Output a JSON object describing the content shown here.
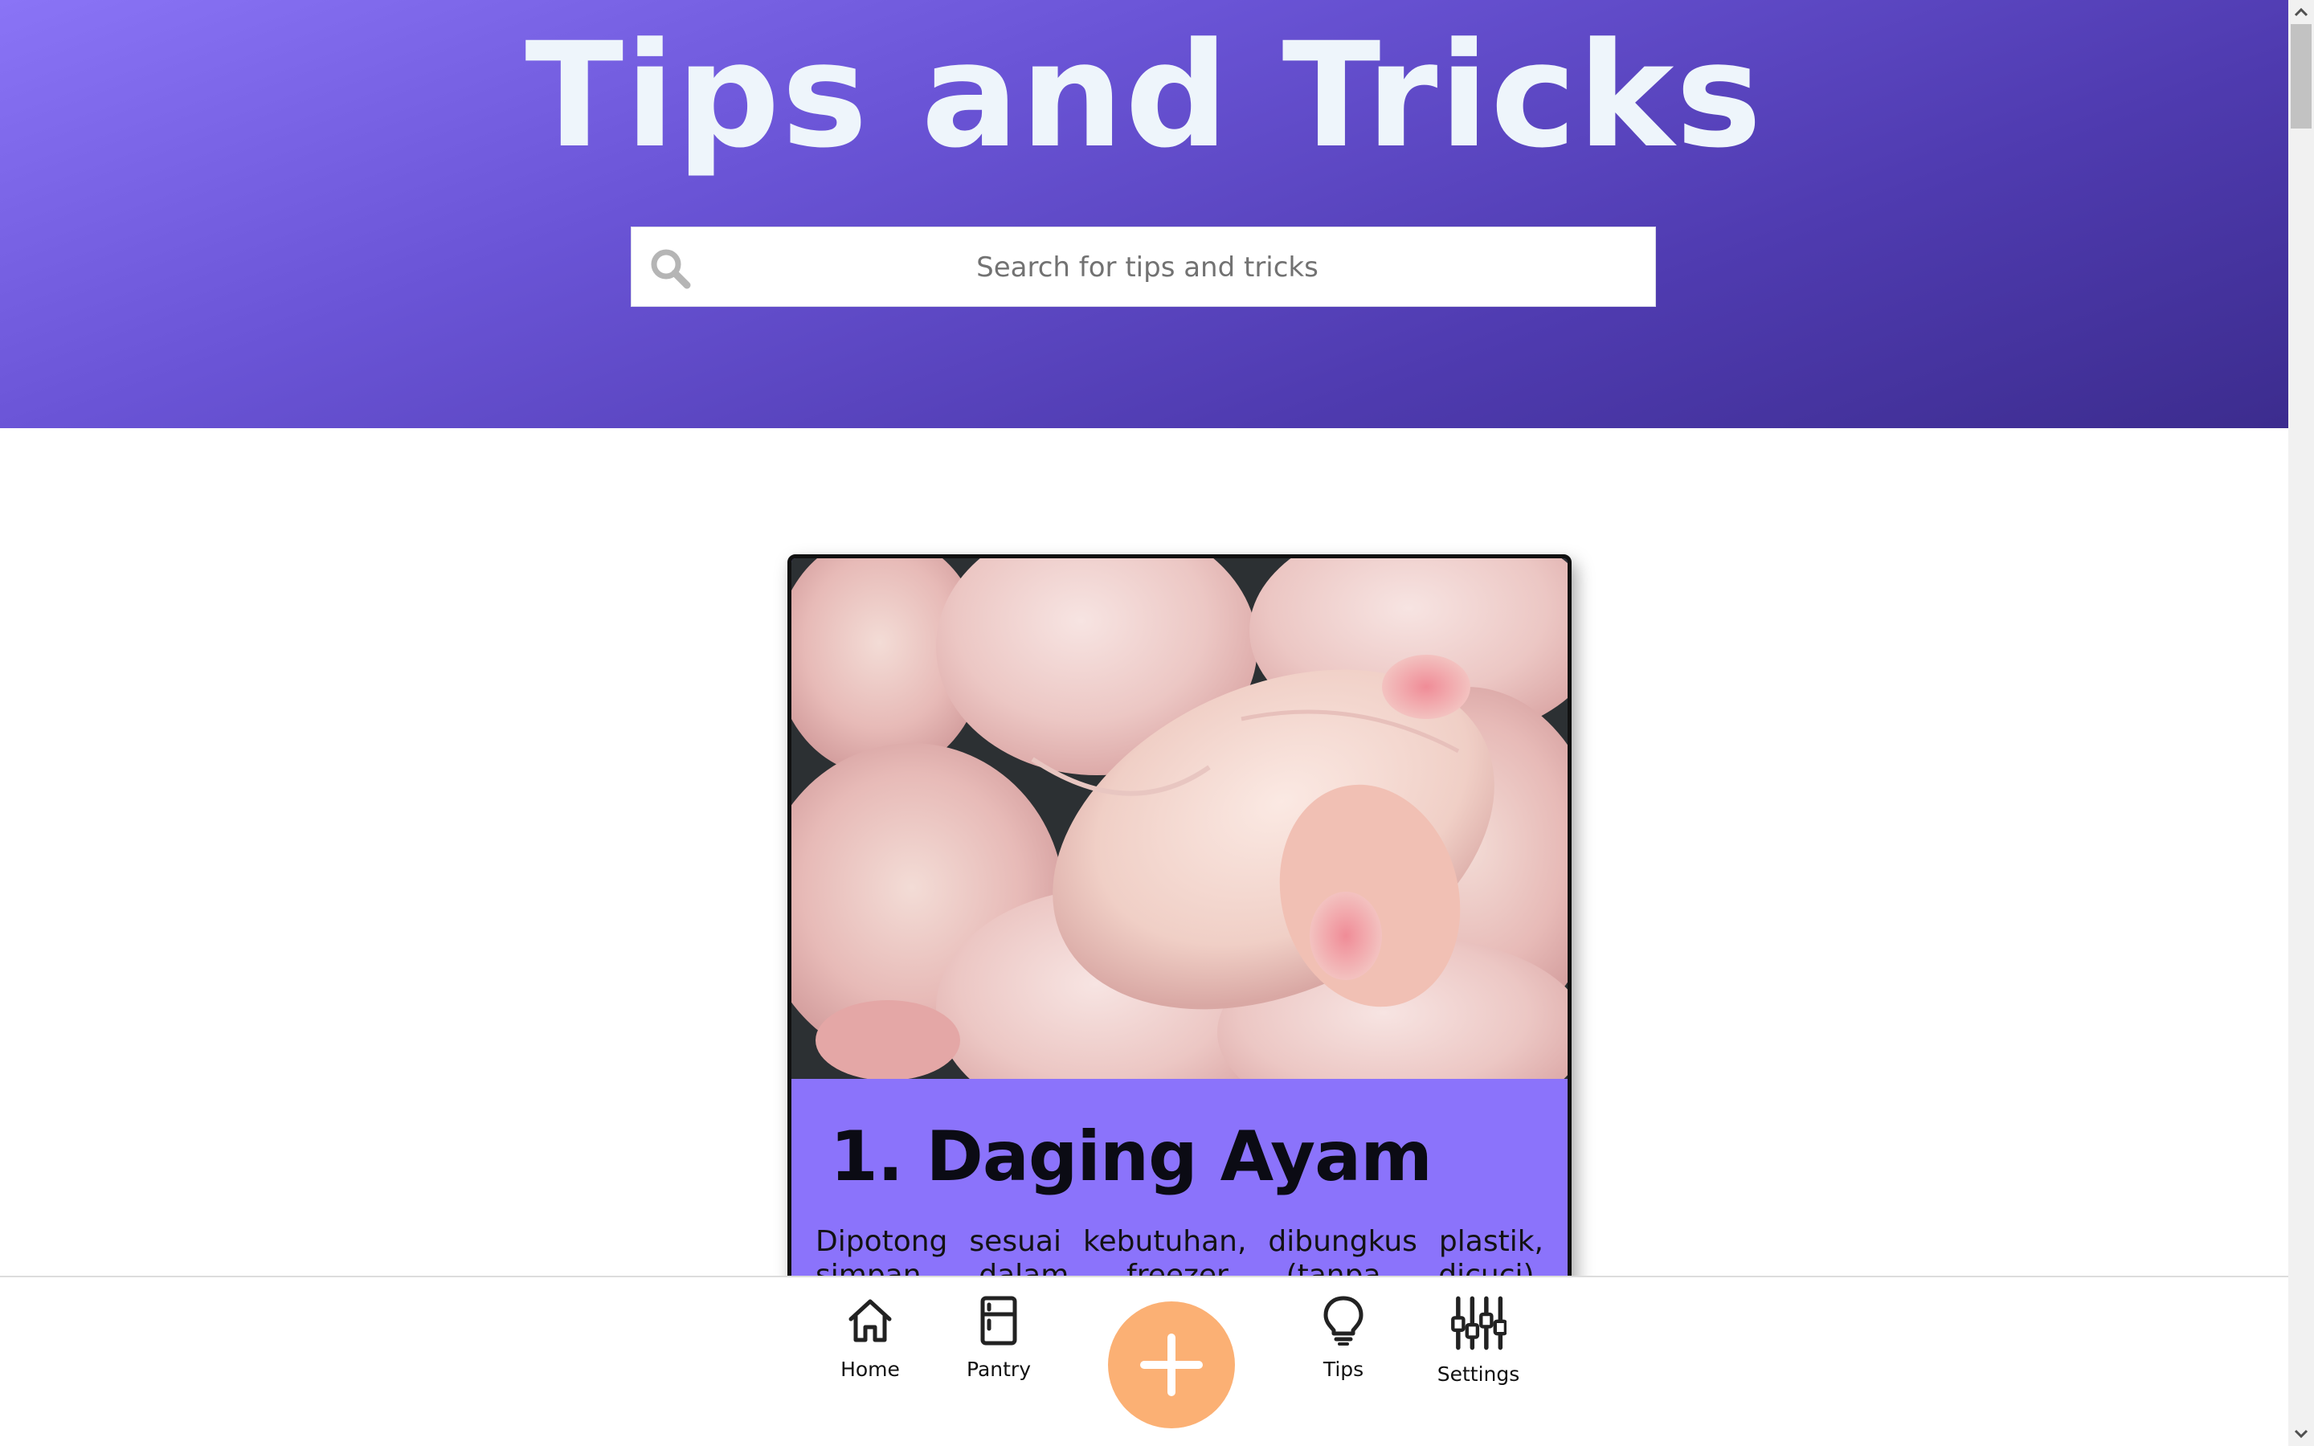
{
  "header": {
    "title": "Tips and Tricks"
  },
  "search": {
    "placeholder": "Search for tips and tricks",
    "value": ""
  },
  "tip_card": {
    "title": "1. Daging Ayam",
    "description": "Dipotong sesuai kebutuhan, dibungkus plastik, simpan dalam freezer (tanpa dicuci).",
    "image_subject": "raw chicken pieces",
    "background_color": "#8b73fb"
  },
  "bottom_nav": {
    "items": [
      {
        "label": "Home",
        "icon": "home-icon"
      },
      {
        "label": "Pantry",
        "icon": "fridge-icon"
      },
      {
        "label": "Tips",
        "icon": "lightbulb-icon"
      },
      {
        "label": "Settings",
        "icon": "sliders-icon"
      }
    ],
    "fab_icon": "plus-icon",
    "fab_color": "#fbb074"
  },
  "colors": {
    "header_gradient_start": "#8a74f6",
    "header_gradient_end": "#3c2c8e",
    "title_text": "#eef5fb"
  }
}
